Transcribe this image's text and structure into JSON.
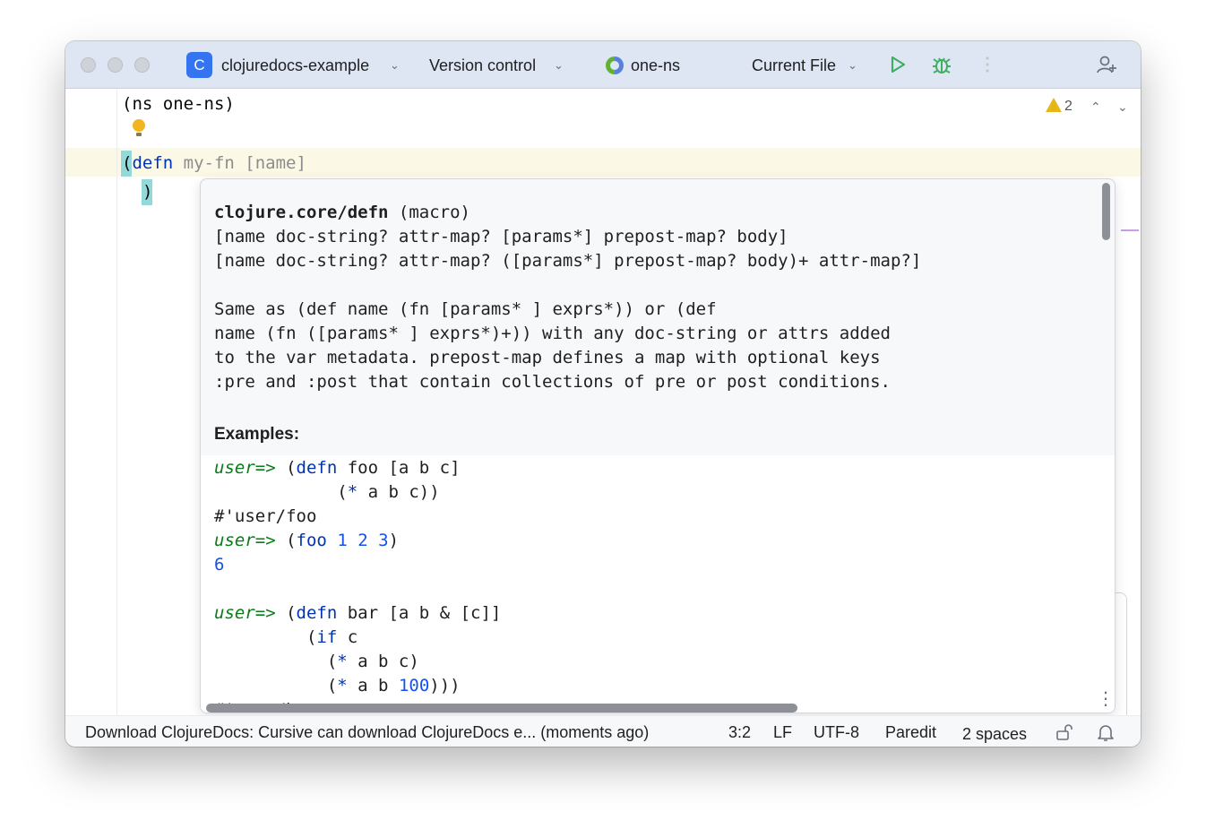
{
  "titlebar": {
    "project_badge": "C",
    "project_name": "clojuredocs-example",
    "vcs": "Version control",
    "namespace": "one-ns",
    "run_config": "Current File"
  },
  "editor": {
    "line1": "(ns one-ns)",
    "line3_open": "(",
    "line3_kw": "defn",
    "line3_rest": " my-fn [name]",
    "line4": ")",
    "warning_count": "2"
  },
  "doc_popup": {
    "signature_name": "clojure.core/defn",
    "signature_kind": " (macro)",
    "arity1": "[name doc-string? attr-map? [params*] prepost-map? body]",
    "arity2": "[name doc-string? attr-map? ([params*] prepost-map? body)+ attr-map?]",
    "desc1": "Same as (def name (fn [params* ] exprs*)) or (def",
    "desc2": "name (fn ([params* ] exprs*)+)) with any doc-string or attrs added",
    "desc3": "to the var metadata. prepost-map defines a map with optional keys",
    "desc4": ":pre and :post that contain collections of pre or post conditions.",
    "examples_heading": "Examples:",
    "examples": {
      "prompt": "user=>",
      "l1_defn": "defn",
      "l1_rest": " foo [a b c]",
      "l2_star": "*",
      "l2_rest": " a b c))",
      "l3": "#'user/foo",
      "l4_fn": "foo",
      "l4_n1": "1",
      "l4_n2": "2",
      "l4_n3": "3",
      "l5": "6",
      "l6_defn": "defn",
      "l6_rest": " bar [a b & [c]]",
      "l7_if": "if",
      "l7_rest": " c",
      "l8_star": "*",
      "l8_rest": " a b c)",
      "l9_star": "*",
      "l9_rest": " a b ",
      "l9_num": "100",
      "l9_close": ")))",
      "l10": "#'user/bar"
    }
  },
  "statusbar": {
    "message": "Download ClojureDocs: Cursive can download ClojureDocs e... (moments ago)",
    "position": "3:2",
    "line_sep": "LF",
    "encoding": "UTF-8",
    "mode": "Paredit",
    "indent": "2 spaces"
  },
  "icons": {
    "run": "play-icon",
    "debug": "bug-icon",
    "account": "add-user-icon",
    "lock": "lock-open-icon",
    "notifications": "bell-icon",
    "warning": "warning-triangle-icon",
    "intention": "lightbulb-icon"
  },
  "colors": {
    "keyword": "#0033b3",
    "prompt": "#067d17",
    "number": "#1750eb",
    "paren_match": "#93d9d9",
    "current_line": "#fcf8e6"
  }
}
